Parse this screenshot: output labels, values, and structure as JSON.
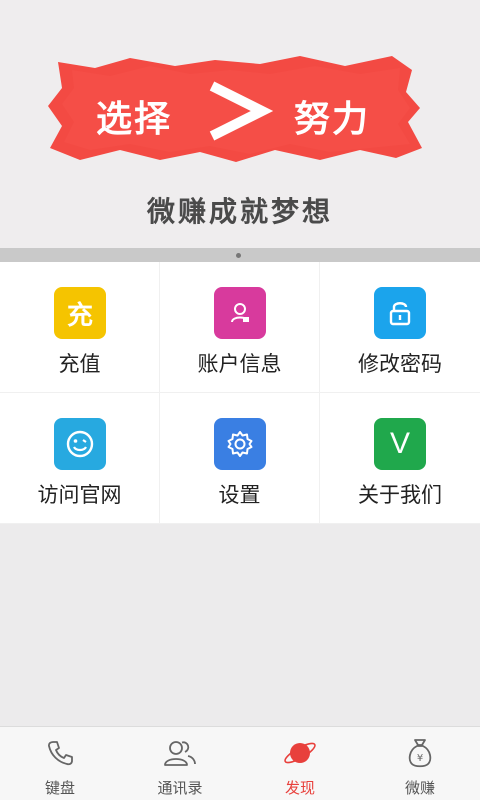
{
  "banner": {
    "slogan_left": "选择",
    "slogan_symbol": ">",
    "slogan_right": "努力",
    "tagline": "微赚成就梦想",
    "accent_color": "#f34a43"
  },
  "grid": {
    "items": [
      {
        "label": "充值",
        "icon": "recharge-icon",
        "color": "#f5c400",
        "glyph": "充"
      },
      {
        "label": "账户信息",
        "icon": "account-icon",
        "color": "#d83a9d"
      },
      {
        "label": "修改密码",
        "icon": "unlock-icon",
        "color": "#1ba4ec"
      },
      {
        "label": "访问官网",
        "icon": "smiley-icon",
        "color": "#27a9e0"
      },
      {
        "label": "设置",
        "icon": "gear-icon",
        "color": "#3a7fe3"
      },
      {
        "label": "关于我们",
        "icon": "v-logo-icon",
        "color": "#20a84c",
        "glyph": "V"
      }
    ]
  },
  "tabbar": {
    "tabs": [
      {
        "label": "键盘",
        "icon": "phone-icon"
      },
      {
        "label": "通讯录",
        "icon": "contacts-icon"
      },
      {
        "label": "发现",
        "icon": "discover-icon",
        "active": true
      },
      {
        "label": "微赚",
        "icon": "money-bag-icon"
      }
    ],
    "active_color": "#e8403c"
  }
}
